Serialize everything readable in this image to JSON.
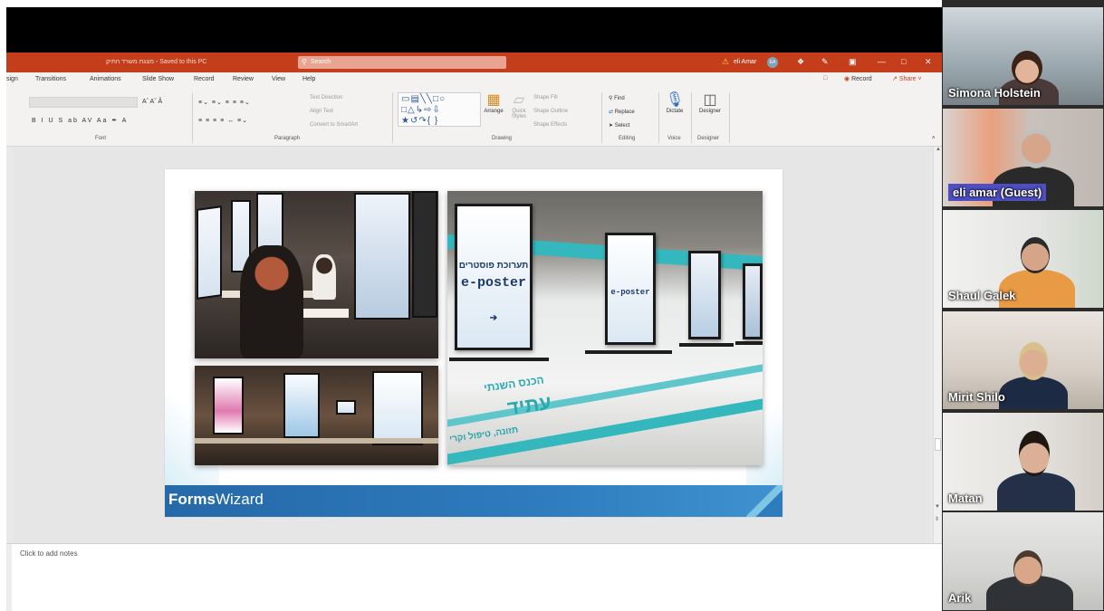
{
  "app": {
    "document_title": "מצגת משרד התיק - Saved to this PC",
    "search_placeholder": "Search",
    "user_name": "eli Amar",
    "user_initials": "EA"
  },
  "ribbon": {
    "tabs": [
      "sign",
      "Transitions",
      "Animations",
      "Slide Show",
      "Record",
      "Review",
      "View",
      "Help"
    ],
    "record_label": "Record",
    "share_label": "Share",
    "groups": {
      "font": "Font",
      "paragraph": "Paragraph",
      "drawing": "Drawing",
      "editing": "Editing",
      "voice": "Voice",
      "designer": "Designer"
    },
    "paragraph_items": [
      "Text Direction",
      "Align Text",
      "Convert to SmartArt"
    ],
    "drawing_items": [
      "Arrange",
      "Quick Styles",
      "Shape Fill",
      "Shape Outline",
      "Shape Effects"
    ],
    "editing_items": [
      "Find",
      "Replace",
      "Select"
    ],
    "voice_label": "Dictate",
    "designer_label": "Designer"
  },
  "slide": {
    "brand_bold": "Forms",
    "brand_light": "Wizard",
    "poster_title_he": "תערוכת פוסטרים",
    "poster_title_en": "e-poster",
    "conference_he": "הכנס השנתי",
    "conference_sub_he": "עתיד",
    "tagline_he": "תזונה, טיפול וקרי"
  },
  "notes": {
    "placeholder": "Click to add notes"
  },
  "participants": [
    {
      "name": "Simona Holstein",
      "highlight": false
    },
    {
      "name": "eli amar (Guest)",
      "highlight": true
    },
    {
      "name": "Shaul Galek",
      "highlight": false
    },
    {
      "name": "Mirit Shilo",
      "highlight": false
    },
    {
      "name": "Matan",
      "highlight": false
    },
    {
      "name": "Arik",
      "highlight": false
    }
  ],
  "colors": {
    "title_bar": "#c43e1c",
    "ribbon": "#f3f2f1",
    "slide_footer": "#2e7bbd",
    "teal": "#34b7bd",
    "name_highlight": "#4f4fc4"
  }
}
